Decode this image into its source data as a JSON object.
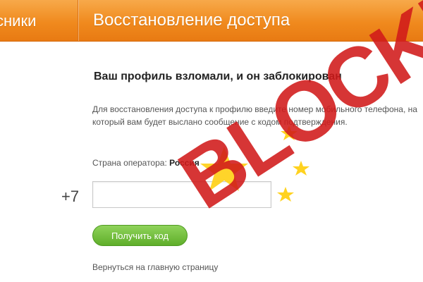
{
  "header": {
    "brand": "Одноклассники",
    "brand_visible": "сники",
    "page_title": "Восстановление доступа"
  },
  "main": {
    "headline": "Ваш профиль взломали, и он заблокирован",
    "description": "Для восстановления доступа к профилю введите номер мобильного телефона, на который вам будет выслано сообщение с кодом подтверждения.",
    "operator_label": "Страна оператора:",
    "operator_value": "Россия",
    "phone_prefix": "+7",
    "phone_value": "",
    "get_code_button": "Получить код",
    "back_link": "Вернуться на главную страницу"
  },
  "overlay": {
    "stamp_text": "BLOCKED",
    "stamp_color": "#d11a1a",
    "star_color": "#ffd21f"
  },
  "colors": {
    "header_orange": "#f08a1e",
    "button_green": "#5fae2a"
  }
}
